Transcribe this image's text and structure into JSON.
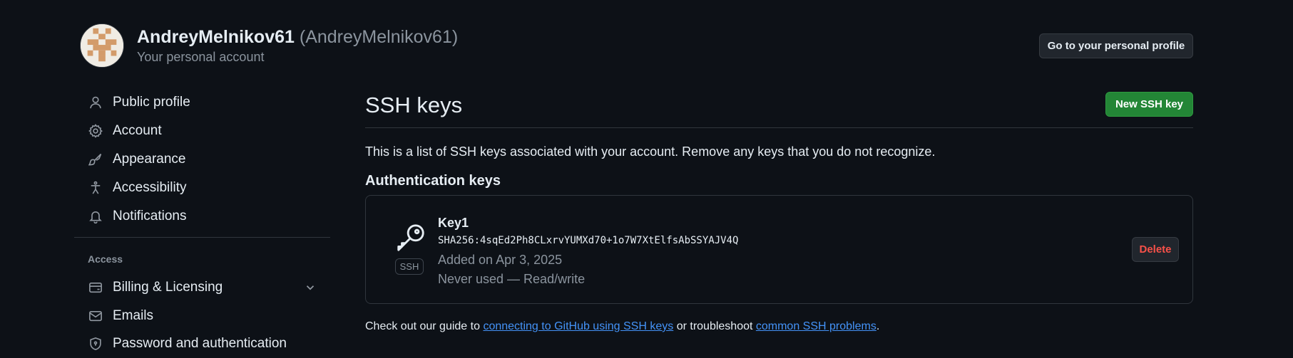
{
  "header": {
    "username": "AndreyMelnikov61",
    "handle": "(AndreyMelnikov61)",
    "subtitle": "Your personal account",
    "profile_button": "Go to your personal profile"
  },
  "sidebar": {
    "items": [
      {
        "label": "Public profile",
        "icon": "person-icon"
      },
      {
        "label": "Account",
        "icon": "gear-icon"
      },
      {
        "label": "Appearance",
        "icon": "paintbrush-icon"
      },
      {
        "label": "Accessibility",
        "icon": "accessibility-icon"
      },
      {
        "label": "Notifications",
        "icon": "bell-icon"
      }
    ],
    "access_heading": "Access",
    "access_items": [
      {
        "label": "Billing & Licensing",
        "icon": "credit-card-icon"
      },
      {
        "label": "Emails",
        "icon": "mail-icon"
      },
      {
        "label": "Password and authentication",
        "icon": "shield-lock-icon"
      }
    ]
  },
  "main": {
    "title": "SSH keys",
    "new_button": "New SSH key",
    "intro": "This is a list of SSH keys associated with your account. Remove any keys that you do not recognize.",
    "auth_heading": "Authentication keys",
    "key": {
      "name": "Key1",
      "fingerprint": "SHA256:4sqEd2Ph8CLxrvYUMXd70+1o7W7XtElfsAbSSYAJV4Q",
      "added": "Added on Apr 3, 2025",
      "usage": "Never used — Read/write",
      "badge": "SSH",
      "delete_button": "Delete"
    },
    "guide": {
      "prefix": "Check out our guide to ",
      "link1": "connecting to GitHub using SSH keys",
      "middle": " or troubleshoot ",
      "link2": "common SSH problems",
      "suffix": "."
    }
  },
  "colors": {
    "background": "#0d1117",
    "primary_button": "#238636",
    "danger": "#f85149",
    "link": "#4493f8"
  }
}
